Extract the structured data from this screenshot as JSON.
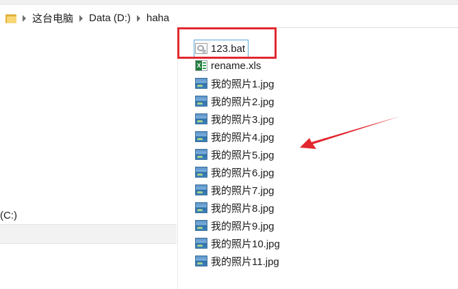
{
  "address": {
    "crumbs": [
      "这台电脑",
      "Data (D:)",
      "haha"
    ]
  },
  "nav": {
    "drive_c_label": "(C:)"
  },
  "files": [
    {
      "name": "123.bat",
      "icon": "bat-file-icon",
      "selected": true
    },
    {
      "name": "rename.xls",
      "icon": "excel-file-icon",
      "selected": false
    },
    {
      "name": "我的照片1.jpg",
      "icon": "image-file-icon",
      "selected": false
    },
    {
      "name": "我的照片2.jpg",
      "icon": "image-file-icon",
      "selected": false
    },
    {
      "name": "我的照片3.jpg",
      "icon": "image-file-icon",
      "selected": false
    },
    {
      "name": "我的照片4.jpg",
      "icon": "image-file-icon",
      "selected": false
    },
    {
      "name": "我的照片5.jpg",
      "icon": "image-file-icon",
      "selected": false
    },
    {
      "name": "我的照片6.jpg",
      "icon": "image-file-icon",
      "selected": false
    },
    {
      "name": "我的照片7.jpg",
      "icon": "image-file-icon",
      "selected": false
    },
    {
      "name": "我的照片8.jpg",
      "icon": "image-file-icon",
      "selected": false
    },
    {
      "name": "我的照片9.jpg",
      "icon": "image-file-icon",
      "selected": false
    },
    {
      "name": "我的照片10.jpg",
      "icon": "image-file-icon",
      "selected": false
    },
    {
      "name": "我的照片11.jpg",
      "icon": "image-file-icon",
      "selected": false
    }
  ],
  "annotation": {
    "color": "#e2272e"
  }
}
